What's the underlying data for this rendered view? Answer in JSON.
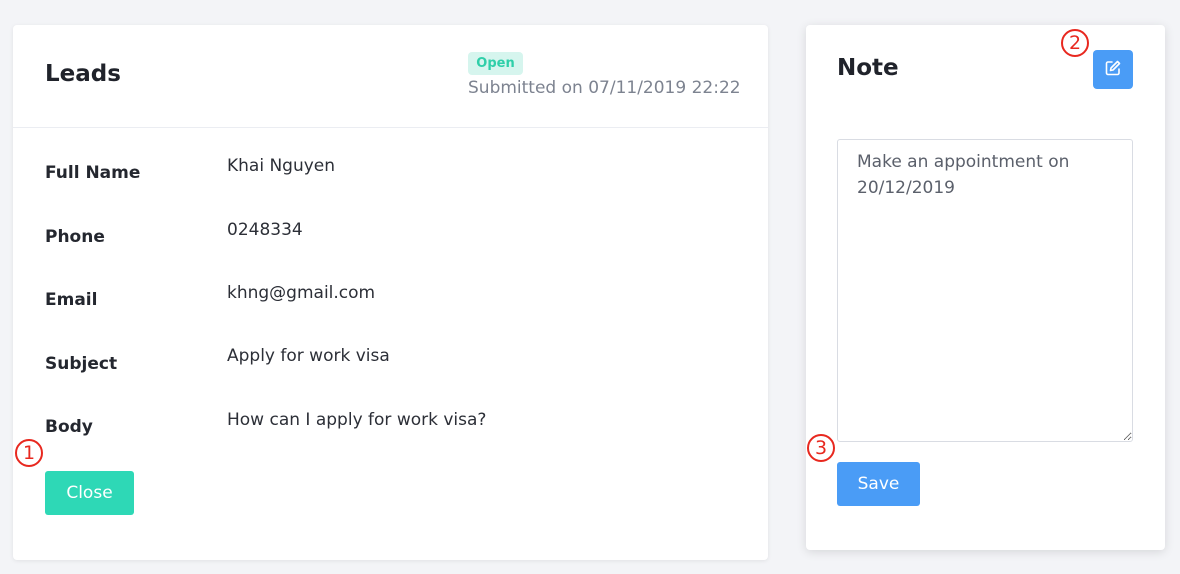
{
  "leads": {
    "title": "Leads",
    "status": "Open",
    "submitted": "Submitted on 07/11/2019 22:22",
    "fields": [
      {
        "label": "Full Name",
        "value": "Khai Nguyen"
      },
      {
        "label": "Phone",
        "value": "0248334"
      },
      {
        "label": "Email",
        "value": "khng@gmail.com"
      },
      {
        "label": "Subject",
        "value": "Apply for work visa"
      },
      {
        "label": "Body",
        "value": "How can I apply for work visa?"
      }
    ],
    "close_label": "Close"
  },
  "note": {
    "title": "Note",
    "text": "Make an appointment on 20/12/2019",
    "save_label": "Save",
    "edit_icon": "edit-icon"
  },
  "markers": [
    "1",
    "2",
    "3"
  ],
  "colors": {
    "accent_teal": "#2ed8b6",
    "accent_blue": "#4a9cf6",
    "badge_bg": "#d6f5ee",
    "marker_red": "#e8281f"
  }
}
